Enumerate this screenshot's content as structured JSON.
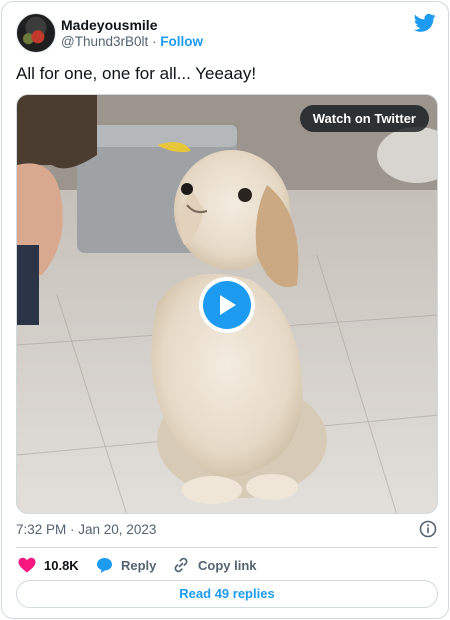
{
  "author": {
    "display_name": "Madeyousmile",
    "handle": "@Thund3rB0lt",
    "separator": "·",
    "follow_label": "Follow"
  },
  "tweet": {
    "text": "All for one, one for all... Yeeaay!",
    "timestamp": "7:32 PM · Jan 20, 2023"
  },
  "media": {
    "watch_label": "Watch on Twitter",
    "icon": "play-icon"
  },
  "actions": {
    "like_count": "10.8K",
    "reply_label": "Reply",
    "copy_label": "Copy link"
  },
  "footer": {
    "read_replies_label": "Read 49 replies"
  },
  "colors": {
    "accent": "#1d9bf0",
    "like": "#f91880",
    "text": "#0f1419",
    "secondary": "#536471",
    "border": "#cfd9de"
  }
}
